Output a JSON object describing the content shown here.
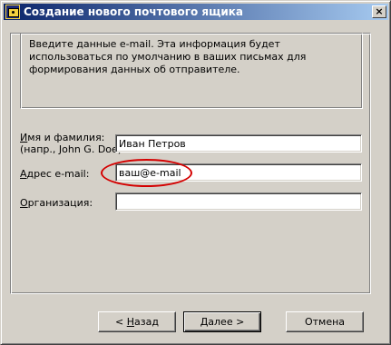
{
  "window": {
    "title": "Создание нового почтового ящика",
    "close_label": "×"
  },
  "info": {
    "text": "Введите данные e-mail. Эта информация будет использоваться по умолчанию в ваших письмах для формирования данных об отправителе."
  },
  "form": {
    "name_label_line1_prefix": "",
    "name_label_acc": "И",
    "name_label_line1_rest": "мя и фамилия:",
    "name_label_line2": "(напр., John G. Doe)",
    "name_value": "Иван Петров",
    "email_label_acc": "А",
    "email_label_rest": "дрес e-mail:",
    "email_value": "ваш@e-mail",
    "org_label_acc": "О",
    "org_label_rest": "рганизация:",
    "org_value": ""
  },
  "buttons": {
    "back_prefix": "< ",
    "back_acc": "Н",
    "back_rest": "азад",
    "next_acc": "Д",
    "next_rest": "алее  >",
    "cancel": "Отмена"
  },
  "colors": {
    "title_start": "#0a246a",
    "title_end": "#a6caf0",
    "face": "#d4d0c8",
    "highlight_ellipse": "#d40000"
  }
}
